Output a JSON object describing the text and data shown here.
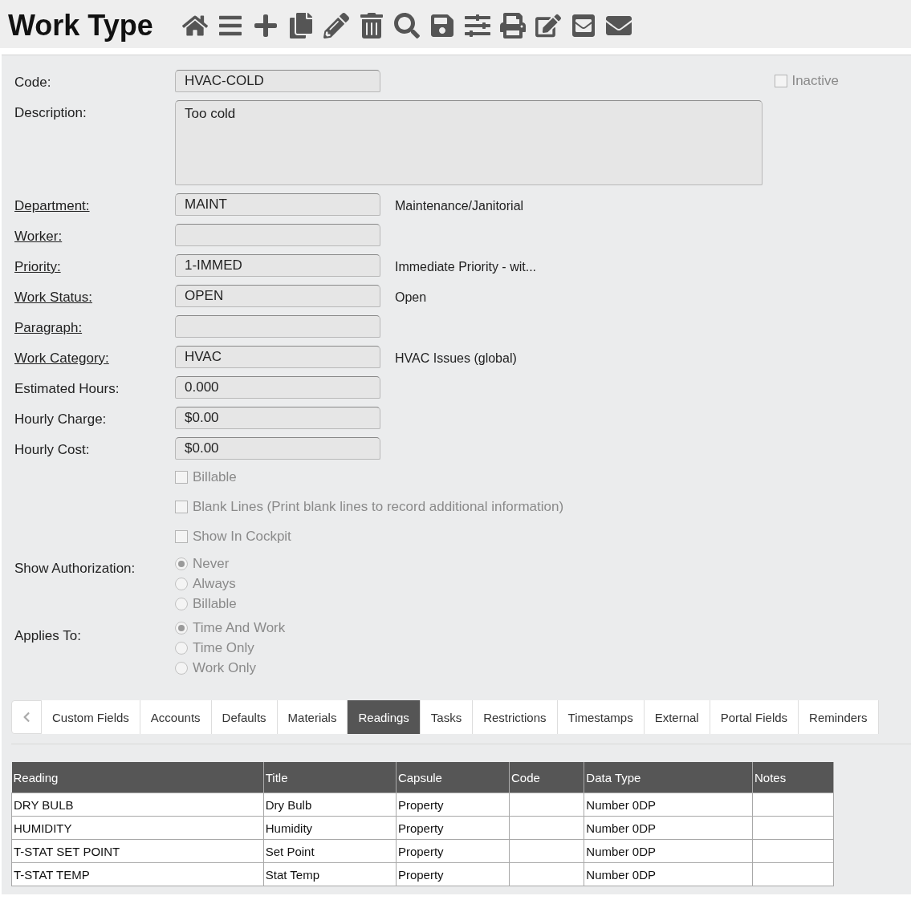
{
  "title": "Work Type",
  "inactive": {
    "label": "Inactive",
    "checked": false
  },
  "fields": [
    {
      "kind": "input",
      "label": "Code:",
      "link": false,
      "value": "HVAC-COLD"
    },
    {
      "kind": "textarea",
      "label": "Description:",
      "link": false,
      "value": "Too cold"
    },
    {
      "kind": "input",
      "label": "Department:",
      "link": true,
      "value": "MAINT",
      "note": "Maintenance/Janitorial"
    },
    {
      "kind": "input",
      "label": "Worker:",
      "link": true
    },
    {
      "kind": "input",
      "label": "Priority:",
      "link": true,
      "value": "1-IMMED",
      "note": "Immediate Priority - wit..."
    },
    {
      "kind": "input",
      "label": "Work Status:",
      "link": true,
      "value": "OPEN",
      "note": "Open"
    },
    {
      "kind": "input",
      "label": "Paragraph:",
      "link": true
    },
    {
      "kind": "input",
      "label": "Work Category:",
      "link": true,
      "value": "HVAC",
      "note": "HVAC Issues (global)"
    },
    {
      "kind": "input",
      "label": "Estimated Hours:",
      "link": false,
      "value": "0.000"
    },
    {
      "kind": "input",
      "label": "Hourly Charge:",
      "link": false,
      "value": "$0.00"
    },
    {
      "kind": "input",
      "label": "Hourly Cost:",
      "link": false,
      "value": "$0.00"
    }
  ],
  "checkboxes": [
    {
      "label": "Billable",
      "checked": false
    },
    {
      "label": "Blank Lines (Print blank lines to record additional information)",
      "checked": false
    },
    {
      "label": "Show In Cockpit",
      "checked": false
    }
  ],
  "radio_groups": [
    {
      "label": "Show Authorization:",
      "options": [
        {
          "label": "Never",
          "selected": true
        },
        {
          "label": "Always",
          "selected": false
        },
        {
          "label": "Billable",
          "selected": false
        }
      ]
    },
    {
      "label": "Applies To:",
      "options": [
        {
          "label": "Time And Work",
          "selected": true
        },
        {
          "label": "Time Only",
          "selected": false
        },
        {
          "label": "Work Only",
          "selected": false
        }
      ]
    }
  ],
  "tabs": [
    {
      "label": "Custom Fields",
      "selected": false
    },
    {
      "label": "Accounts",
      "selected": false
    },
    {
      "label": "Defaults",
      "selected": false
    },
    {
      "label": "Materials",
      "selected": false
    },
    {
      "label": "Readings",
      "selected": true
    },
    {
      "label": "Tasks",
      "selected": false
    },
    {
      "label": "Restrictions",
      "selected": false
    },
    {
      "label": "Timestamps",
      "selected": false
    },
    {
      "label": "External",
      "selected": false
    },
    {
      "label": "Portal Fields",
      "selected": false
    },
    {
      "label": "Reminders",
      "selected": false
    }
  ],
  "table": {
    "columns": [
      "Reading",
      "Title",
      "Capsule",
      "Code",
      "Data Type",
      "Notes"
    ],
    "rows": [
      [
        "DRY BULB",
        "Dry Bulb",
        "Property",
        "",
        "Number 0DP",
        ""
      ],
      [
        "HUMIDITY",
        "Humidity",
        "Property",
        "",
        "Number 0DP",
        ""
      ],
      [
        "T-STAT SET POINT",
        "Set Point",
        "Property",
        "",
        "Number 0DP",
        ""
      ],
      [
        "T-STAT TEMP",
        "Stat Temp",
        "Property",
        "",
        "Number 0DP",
        ""
      ]
    ]
  }
}
